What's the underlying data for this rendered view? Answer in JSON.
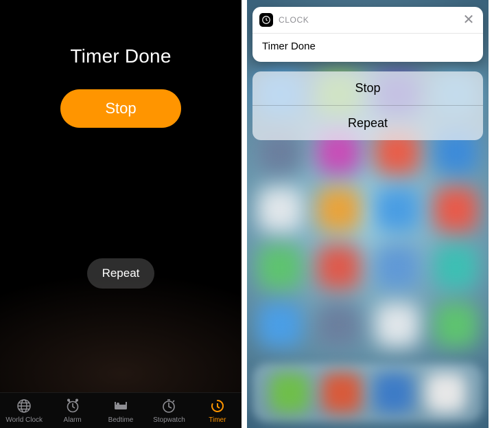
{
  "left": {
    "title": "Timer Done",
    "stop_label": "Stop",
    "repeat_label": "Repeat",
    "tabs": [
      {
        "label": "World Clock"
      },
      {
        "label": "Alarm"
      },
      {
        "label": "Bedtime"
      },
      {
        "label": "Stopwatch"
      },
      {
        "label": "Timer"
      }
    ]
  },
  "right": {
    "app_name": "CLOCK",
    "notif_title": "Timer Done",
    "actions": {
      "stop": "Stop",
      "repeat": "Repeat"
    }
  }
}
